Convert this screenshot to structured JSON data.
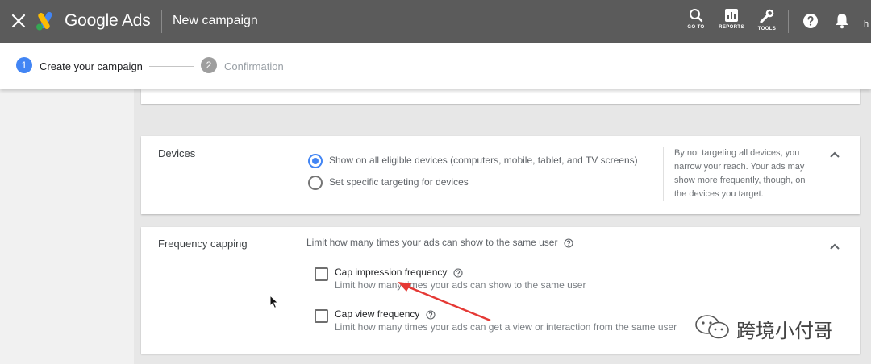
{
  "topbar": {
    "brand": "Google Ads",
    "title": "New campaign",
    "actions": [
      {
        "label": "GO TO",
        "icon": "search-icon"
      },
      {
        "label": "REPORTS",
        "icon": "reports-icon"
      },
      {
        "label": "TOOLS",
        "icon": "wrench-icon"
      }
    ],
    "user_initial": "h",
    "bg_color": "#5b5b5b"
  },
  "stepper": {
    "steps": [
      {
        "number": "1",
        "label": "Create your campaign",
        "state": "active"
      },
      {
        "number": "2",
        "label": "Confirmation",
        "state": "inactive"
      }
    ],
    "accent_color": "#4285f4"
  },
  "devices": {
    "label": "Devices",
    "options": [
      {
        "label": "Show on all eligible devices (computers, mobile, tablet, and TV screens)",
        "selected": true
      },
      {
        "label": "Set specific targeting for devices",
        "selected": false
      }
    ],
    "help": "By not targeting all devices, you narrow your reach. Your ads may show more frequently, though, on the devices you target."
  },
  "frequency_capping": {
    "label": "Frequency capping",
    "description": "Limit how many times your ads can show to the same user",
    "options": [
      {
        "title": "Cap impression frequency",
        "subtitle": "Limit how many times your ads can show to the same user",
        "checked": false
      },
      {
        "title": "Cap view frequency",
        "subtitle": "Limit how many times your ads can get a view or interaction from the same user",
        "checked": false
      }
    ]
  },
  "watermark": {
    "text": "跨境小付哥",
    "icon": "wechat-icon"
  },
  "annotation": {
    "arrow_color": "#e53935"
  }
}
